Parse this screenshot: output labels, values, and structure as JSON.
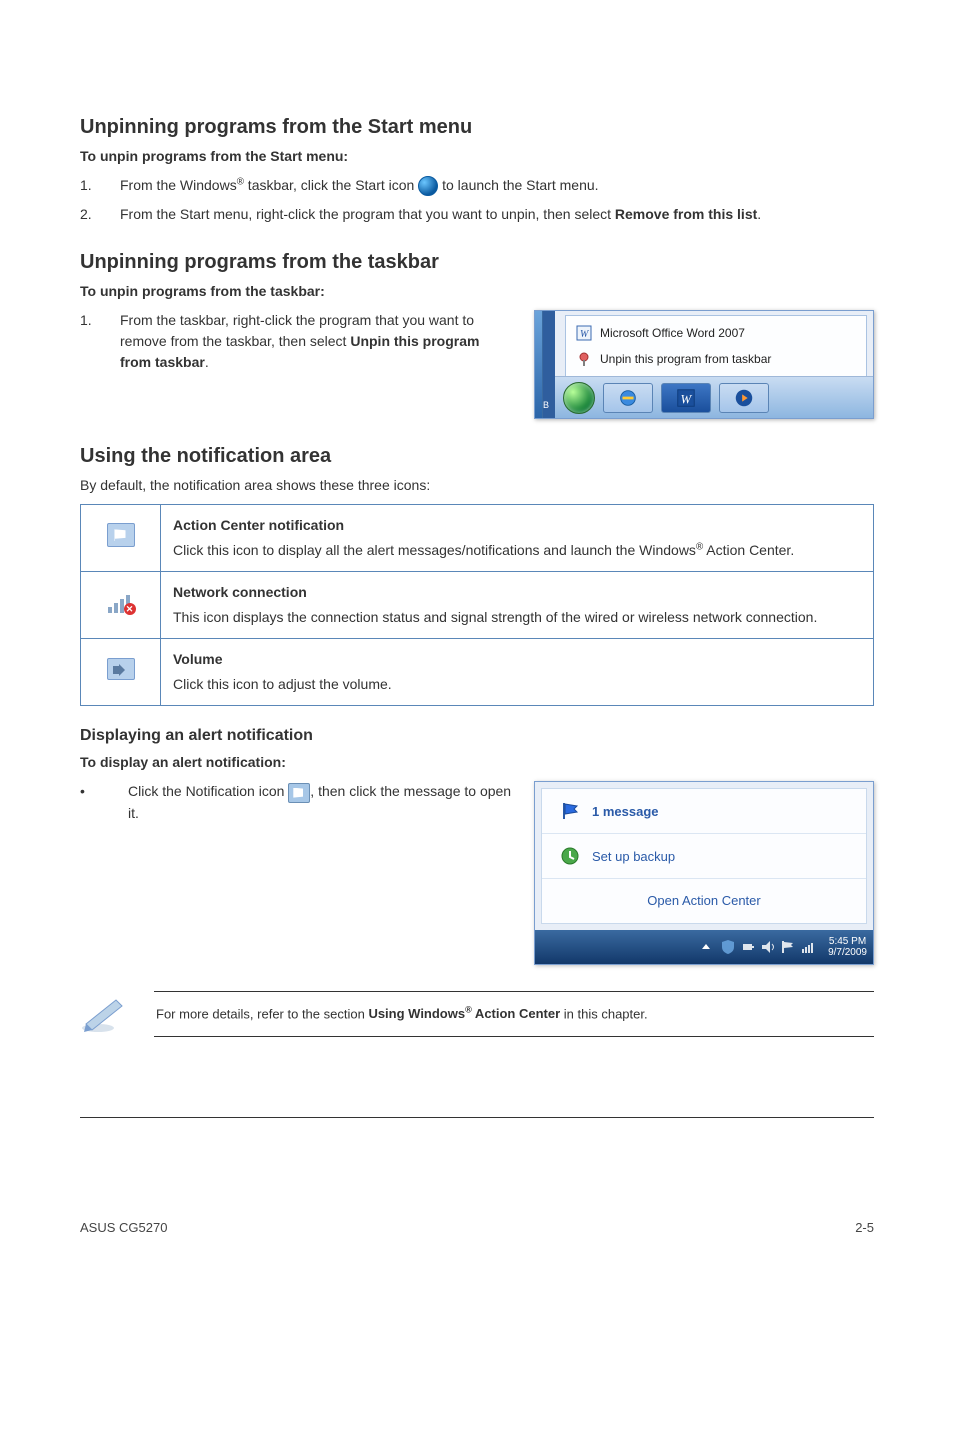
{
  "s1": {
    "heading": "Unpinning programs from the Start menu",
    "sub": "To unpin programs from the Start menu:",
    "step1_num": "1.",
    "step1_a": "From the Windows",
    "step1_b": " taskbar, click the Start icon ",
    "step1_c": " to launch the Start menu.",
    "step2_num": "2.",
    "step2_a": "From the Start menu, right-click the program that you want to unpin, then select ",
    "step2_bold": "Remove from this list",
    "step2_c": "."
  },
  "s2": {
    "heading": "Unpinning programs from the taskbar",
    "sub": "To unpin programs from the taskbar:",
    "step1_num": "1.",
    "step1_a": "From the taskbar, right-click the program that you want to remove from the taskbar, then select ",
    "step1_bold": "Unpin this program from taskbar",
    "step1_c": "."
  },
  "jump": {
    "item1": "Microsoft Office Word 2007",
    "item2": "Unpin this program from taskbar"
  },
  "s3": {
    "heading": "Using the notification area",
    "intro": "By default, the notification area shows these three icons:"
  },
  "table": {
    "r1_title": "Action Center notification",
    "r1_body_a": "Click this icon to display all the alert messages/notifications and launch the Windows",
    "r1_body_b": " Action Center.",
    "r2_title": "Network connection",
    "r2_body": "This icon displays the connection status and signal strength of the wired or wireless network connection.",
    "r3_title": "Volume",
    "r3_body": "Click this icon to adjust the volume."
  },
  "s4": {
    "heading": "Displaying an alert notification",
    "sub": "To display an alert notification:",
    "bullet_dot": "•",
    "bullet_a": "Click the Notification icon ",
    "bullet_b": ", then click the message to open it."
  },
  "alert": {
    "msg": "1 message",
    "backup": "Set up backup",
    "open": "Open Action Center",
    "time": "5:45 PM",
    "date": "9/7/2009"
  },
  "note_a": "For more details, refer to the section ",
  "note_bold_a": "Using Windows",
  "note_bold_b": " Action Center",
  "note_c": " in this chapter.",
  "footer_left": "ASUS CG5270",
  "footer_right": "2-5",
  "reg": "®"
}
